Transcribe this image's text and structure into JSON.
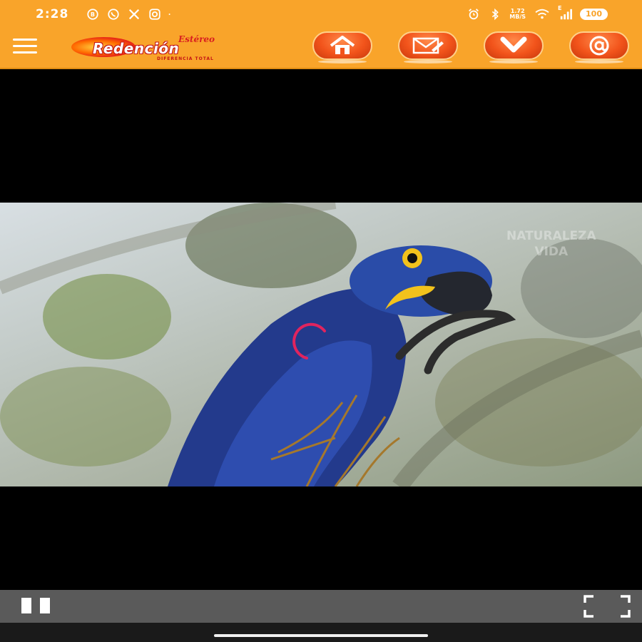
{
  "status_bar": {
    "time": "2:28",
    "network_speed_value": "1.72",
    "network_speed_unit": "MB/S",
    "signal_label": "E",
    "battery": "100",
    "left_icons": [
      "whatsapp-business-icon",
      "whatsapp-icon",
      "x-icon",
      "instagram-icon",
      "dot-icon"
    ],
    "right_icons": [
      "alarm-icon",
      "bluetooth-icon",
      "network-speed",
      "wifi-icon",
      "signal-icon",
      "battery-icon"
    ]
  },
  "header": {
    "logo": {
      "top_word": "Estéreo",
      "main_word": "Redención",
      "tagline": "DIFERENCIA TOTAL"
    },
    "nav_buttons": [
      "home-icon",
      "mail-icon",
      "chevron-down-icon",
      "at-sign-icon"
    ],
    "colors": {
      "background": "#f9a42a",
      "button": "#f2541b"
    }
  },
  "video": {
    "watermark_line1": "NATURALEZA",
    "watermark_line2": "VIDA",
    "state": "playing"
  },
  "controls": {
    "icons": [
      "pause-icon",
      "fullscreen-icon"
    ]
  }
}
